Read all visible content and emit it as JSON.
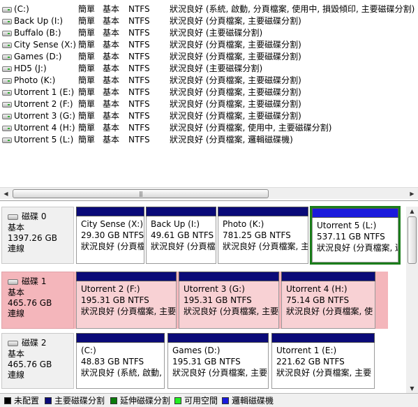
{
  "volumes": [
    {
      "name": " (C:)",
      "layout": "簡單",
      "type": "基本",
      "fs": "NTFS",
      "status": "狀況良好 (系統, 啟動, 分頁檔案, 使用中, 損毀傾印, 主要磁碟分割)"
    },
    {
      "name": "Back Up (I:)",
      "layout": "簡單",
      "type": "基本",
      "fs": "NTFS",
      "status": "狀況良好 (分頁檔案, 主要磁碟分割)"
    },
    {
      "name": "Buffalo (B:)",
      "layout": "簡單",
      "type": "基本",
      "fs": "NTFS",
      "status": "狀況良好 (主要磁碟分割)"
    },
    {
      "name": "City Sense (X:)",
      "layout": "簡單",
      "type": "基本",
      "fs": "NTFS",
      "status": "狀況良好 (分頁檔案, 主要磁碟分割)"
    },
    {
      "name": "Games (D:)",
      "layout": "簡單",
      "type": "基本",
      "fs": "NTFS",
      "status": "狀況良好 (分頁檔案, 主要磁碟分割)"
    },
    {
      "name": "HD5 (J:)",
      "layout": "簡單",
      "type": "基本",
      "fs": "NTFS",
      "status": "狀況良好 (主要磁碟分割)"
    },
    {
      "name": "Photo (K:)",
      "layout": "簡單",
      "type": "基本",
      "fs": "NTFS",
      "status": "狀況良好 (分頁檔案, 主要磁碟分割)"
    },
    {
      "name": "Utorrent 1 (E:)",
      "layout": "簡單",
      "type": "基本",
      "fs": "NTFS",
      "status": "狀況良好 (分頁檔案, 主要磁碟分割)"
    },
    {
      "name": "Utorrent 2 (F:)",
      "layout": "簡單",
      "type": "基本",
      "fs": "NTFS",
      "status": "狀況良好 (分頁檔案, 主要磁碟分割)"
    },
    {
      "name": "Utorrent 3 (G:)",
      "layout": "簡單",
      "type": "基本",
      "fs": "NTFS",
      "status": "狀況良好 (分頁檔案, 主要磁碟分割)"
    },
    {
      "name": "Utorrent 4 (H:)",
      "layout": "簡單",
      "type": "基本",
      "fs": "NTFS",
      "status": "狀況良好 (分頁檔案, 使用中, 主要磁碟分割)"
    },
    {
      "name": "Utorrent 5 (L:)",
      "layout": "簡單",
      "type": "基本",
      "fs": "NTFS",
      "status": "狀況良好 (分頁檔案, 邏輯磁碟機)"
    }
  ],
  "disks": [
    {
      "name": "磁碟 0",
      "type": "基本",
      "size": "1397.26 GB",
      "state": "連線",
      "partitions": [
        {
          "name": "City Sense  (X:)",
          "size": "29.30 GB NTFS",
          "status": "狀況良好 (分頁檔"
        },
        {
          "name": "Back Up  (I:)",
          "size": "49.61 GB NTFS",
          "status": "狀況良好 (分頁檔"
        },
        {
          "name": "Photo  (K:)",
          "size": "781.25 GB NTFS",
          "status": "狀況良好 (分頁檔案, 主"
        },
        {
          "name": "Utorrent 5  (L:)",
          "size": "537.11 GB NTFS",
          "status": "狀況良好 (分頁檔案, 邏"
        }
      ]
    },
    {
      "name": "磁碟 1",
      "type": "基本",
      "size": "465.76 GB",
      "state": "連線",
      "partitions": [
        {
          "name": "Utorrent 2  (F:)",
          "size": "195.31 GB NTFS",
          "status": "狀況良好 (分頁檔案, 主要"
        },
        {
          "name": "Utorrent 3  (G:)",
          "size": "195.31 GB NTFS",
          "status": "狀況良好 (分頁檔案, 主要"
        },
        {
          "name": "Utorrent 4  (H:)",
          "size": "75.14 GB NTFS",
          "status": "狀況良好 (分頁檔案, 使"
        }
      ]
    },
    {
      "name": "磁碟 2",
      "type": "基本",
      "size": "465.76 GB",
      "state": "連線",
      "partitions": [
        {
          "name": " (C:)",
          "size": "48.83 GB NTFS",
          "status": "狀況良好 (系統, 啟動,"
        },
        {
          "name": "Games  (D:)",
          "size": "195.31 GB NTFS",
          "status": "狀況良好 (分頁檔案, 主要"
        },
        {
          "name": "Utorrent 1  (E:)",
          "size": "221.62 GB NTFS",
          "status": "狀況良好 (分頁檔案, 主要"
        }
      ]
    }
  ],
  "legend": [
    {
      "label": "未配置",
      "color": "#000000"
    },
    {
      "label": "主要磁碟分割",
      "color": "#0a0a78"
    },
    {
      "label": "延伸磁碟分割",
      "color": "#0b7a0b"
    },
    {
      "label": "可用空間",
      "color": "#22ee22"
    },
    {
      "label": "邏輯磁碟機",
      "color": "#1a1adc"
    }
  ]
}
